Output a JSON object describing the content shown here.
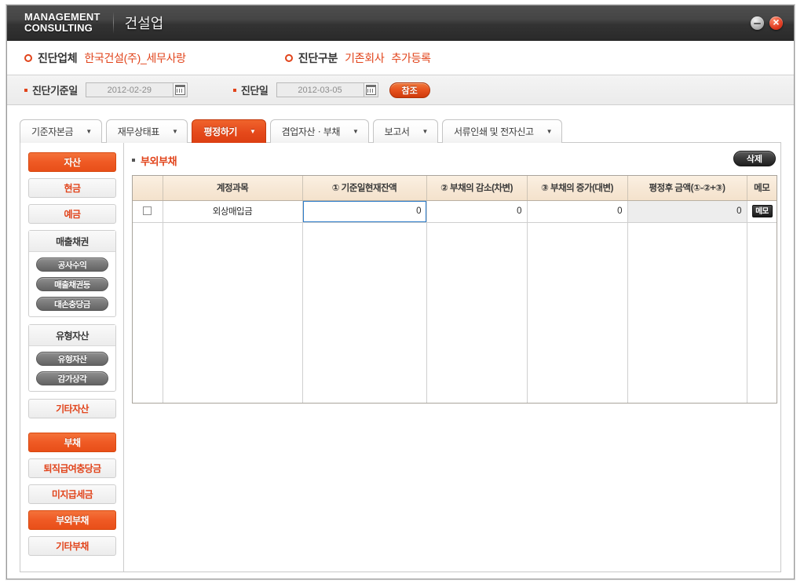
{
  "window": {
    "brand_line1": "MANAGEMENT",
    "brand_line2": "CONSULTING",
    "brand_sub": "건설업",
    "minimize_label": "최소화",
    "close_label": "닫기"
  },
  "info_bar": {
    "company_label": "진단업체",
    "company_value": "한국건설(주)_세무사랑",
    "type_label": "진단구분",
    "type_value_1": "기존회사",
    "type_value_2": "추가등록"
  },
  "date_bar": {
    "base_date_label": "진단기준일",
    "base_date_value": "2012-02-29",
    "diag_date_label": "진단일",
    "diag_date_value": "2012-03-05",
    "reference_button": "참조",
    "calendar_icon": "calendar-icon"
  },
  "tabs": [
    {
      "label": "기준자본금",
      "caret": "▼",
      "active": false
    },
    {
      "label": "재무상태표",
      "caret": "▼",
      "active": false
    },
    {
      "label": "평정하기",
      "caret": "▼",
      "active": true
    },
    {
      "label": "겸업자산ㆍ부채",
      "caret": "▼",
      "active": false
    },
    {
      "label": "보고서",
      "caret": "▼",
      "active": false
    },
    {
      "label": "서류인쇄 및 전자신고",
      "caret": "▼",
      "active": false
    }
  ],
  "sidebar": {
    "items": [
      {
        "kind": "button",
        "label": "자산",
        "style": "accent"
      },
      {
        "kind": "button",
        "label": "현금",
        "style": "red-text"
      },
      {
        "kind": "button",
        "label": "예금",
        "style": "red-text"
      },
      {
        "kind": "group",
        "label": "매출채권",
        "children": [
          "공사수익",
          "매출채권등",
          "대손충당금"
        ]
      },
      {
        "kind": "group",
        "label": "유형자산",
        "children": [
          "유형자산",
          "감가상각"
        ]
      },
      {
        "kind": "button",
        "label": "기타자산",
        "style": "red-text"
      },
      {
        "kind": "button",
        "label": "부채",
        "style": "accent"
      },
      {
        "kind": "button",
        "label": "퇴직급여충당금",
        "style": "red-text"
      },
      {
        "kind": "button",
        "label": "미지급세금",
        "style": "red-text"
      },
      {
        "kind": "button",
        "label": "부외부채",
        "style": "accent"
      },
      {
        "kind": "button",
        "label": "기타부채",
        "style": "red-text"
      }
    ]
  },
  "main": {
    "section_title": "부외부채",
    "delete_button": "삭제",
    "table": {
      "headers": [
        "",
        "계정과목",
        "① 기준일현재잔액",
        "② 부채의 감소(차변)",
        "③ 부채의 증가(대변)",
        "평정후 금액(①-②+③)",
        "메모"
      ],
      "rows": [
        {
          "checked": false,
          "account": "외상매입금",
          "balance": "0",
          "decrease": "0",
          "increase": "0",
          "after": "0",
          "memo_button": "메모"
        }
      ]
    }
  },
  "colors": {
    "accent_orange": "#e8471c",
    "accent_orange_light": "#ef5a24",
    "header_cream": "#f7e8d6",
    "selected_cell_blue": "#3d90e3",
    "titlebar_dark": "#3a3a3a"
  }
}
